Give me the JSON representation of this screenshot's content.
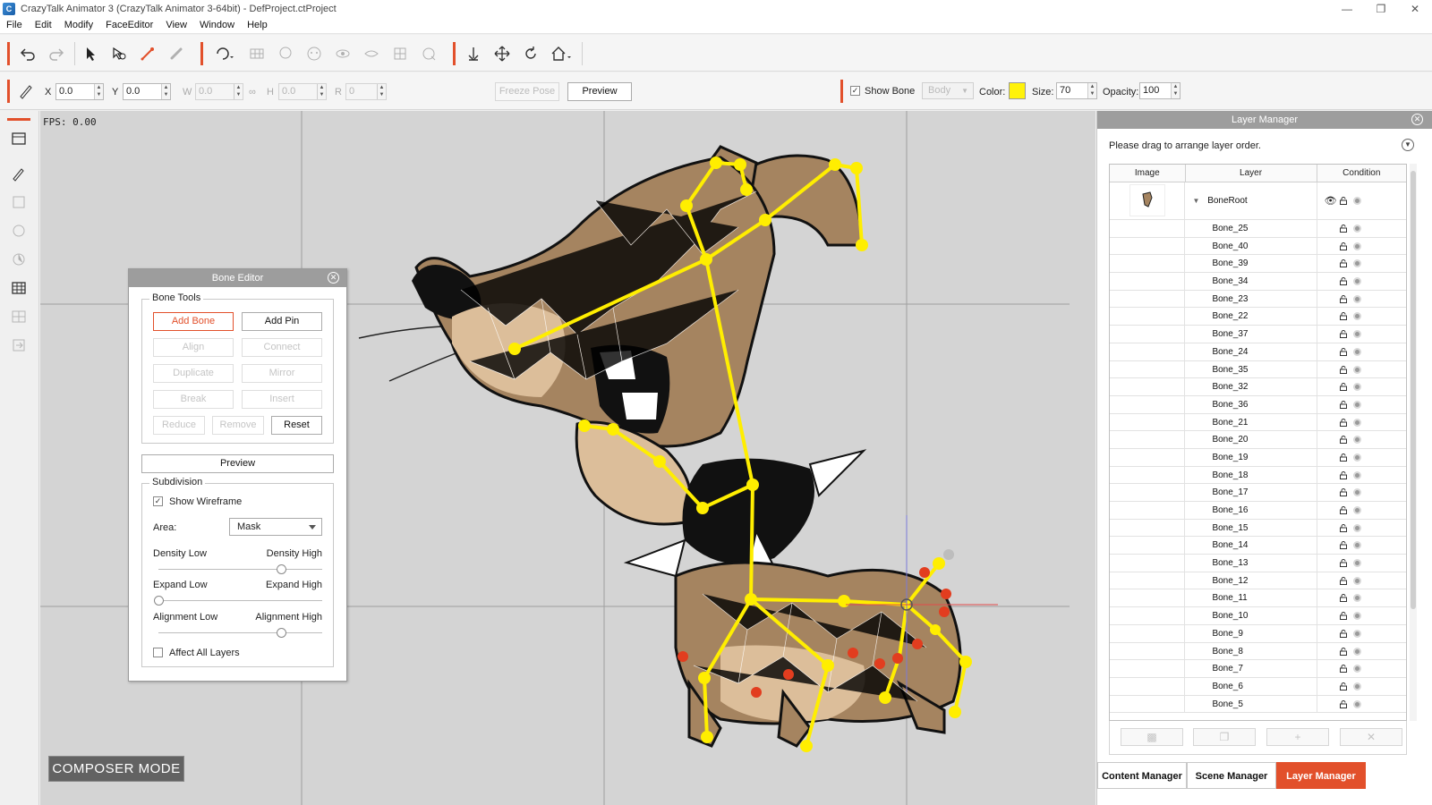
{
  "window": {
    "title": "CrazyTalk Animator 3  (CrazyTalk Animator 3-64bit) - DefProject.ctProject",
    "app_icon_glyph": "C"
  },
  "menu": [
    "File",
    "Edit",
    "Modify",
    "FaceEditor",
    "View",
    "Window",
    "Help"
  ],
  "toolbar1_icons": [
    "undo-icon",
    "redo-icon",
    "select-arrow-icon",
    "rotate-select-icon",
    "bone-edit-icon",
    "link-icon",
    "sprite-editor-icon",
    "grid-icon",
    "head-icon",
    "face-icon",
    "eye-icon",
    "lip-icon",
    "morph-icon",
    "timeline-icon",
    "anchor-icon",
    "move-icon",
    "rotate-icon",
    "home-icon"
  ],
  "transform_bar": {
    "x_label": "X",
    "x_value": "0.0",
    "y_label": "Y",
    "y_value": "0.0",
    "w_label": "W",
    "w_value": "0.0",
    "h_label": "H",
    "h_value": "0.0",
    "r_label": "R",
    "r_value": "0",
    "freeze_pose_label": "Freeze Pose",
    "preview_label": "Preview",
    "show_bone_label": "Show Bone",
    "show_bone_checked": true,
    "body_dropdown": "Body",
    "color_label": "Color:",
    "color_value": "#fff20a",
    "size_label": "Size:",
    "size_value": "70",
    "opacity_label": "Opacity:",
    "opacity_value": "100"
  },
  "viewport": {
    "fps_text": "FPS: 0.00",
    "composer_mode_label": "COMPOSER MODE"
  },
  "bone_editor": {
    "title": "Bone Editor",
    "bone_tools_title": "Bone Tools",
    "add_bone": "Add Bone",
    "add_pin": "Add Pin",
    "align": "Align",
    "connect": "Connect",
    "duplicate": "Duplicate",
    "mirror": "Mirror",
    "break": "Break",
    "insert": "Insert",
    "reduce": "Reduce",
    "remove": "Remove",
    "reset": "Reset",
    "preview": "Preview",
    "subdivision_title": "Subdivision",
    "show_wireframe": "Show Wireframe",
    "show_wireframe_checked": true,
    "area_label": "Area:",
    "area_value": "Mask",
    "density_low": "Density Low",
    "density_high": "Density High",
    "density_level": 0.75,
    "expand_low": "Expand Low",
    "expand_high": "Expand High",
    "expand_level": 0.0,
    "alignment_low": "Alignment Low",
    "alignment_high": "Alignment High",
    "alignment_level": 0.75,
    "affect_all_layers": "Affect All  Layers",
    "affect_all_checked": false
  },
  "layer_manager": {
    "title": "Layer Manager",
    "hint": "Please drag to arrange layer order.",
    "col_image": "Image",
    "col_layer": "Layer",
    "col_condition": "Condition",
    "root": "BoneRoot",
    "layers": [
      "Bone_25",
      "Bone_40",
      "Bone_39",
      "Bone_34",
      "Bone_23",
      "Bone_22",
      "Bone_37",
      "Bone_24",
      "Bone_35",
      "Bone_32",
      "Bone_36",
      "Bone_21",
      "Bone_20",
      "Bone_19",
      "Bone_18",
      "Bone_17",
      "Bone_16",
      "Bone_15",
      "Bone_14",
      "Bone_13",
      "Bone_12",
      "Bone_11",
      "Bone_10",
      "Bone_9",
      "Bone_8",
      "Bone_7",
      "Bone_6",
      "Bone_5"
    ],
    "footer_buttons": [
      "group-icon",
      "duplicate-icon",
      "add-icon",
      "delete-icon"
    ]
  },
  "tabs": [
    "Content Manager",
    "Scene Manager",
    "Layer Manager"
  ],
  "accent_color": "#e2502b"
}
